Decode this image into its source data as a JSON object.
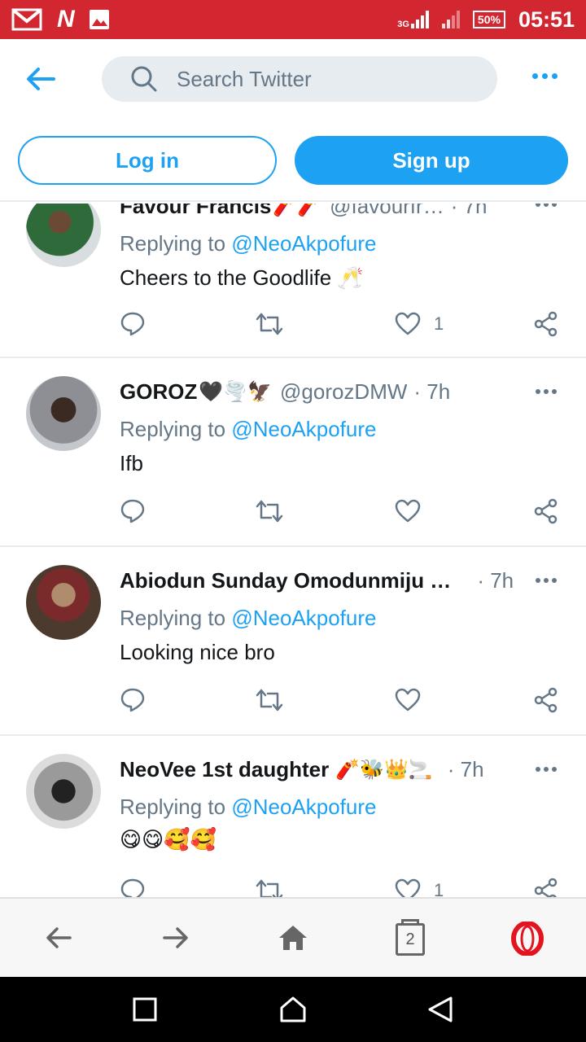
{
  "status_bar": {
    "network_type": "3G",
    "battery": "50%",
    "time": "05:51"
  },
  "header": {
    "search_placeholder": "Search Twitter",
    "login_label": "Log in",
    "signup_label": "Sign up"
  },
  "tweets": [
    {
      "name": "Favour Francis",
      "name_emoji": "🧨🧨",
      "handle": "@favourfr…",
      "time": "· 7h",
      "reply_prefix": "Replying to ",
      "reply_to": "@NeoAkpofure",
      "text": "Cheers to the Goodlife 🥂",
      "like_count": "1"
    },
    {
      "name": "GOROZ",
      "name_emoji": "🖤🌪️🦅",
      "handle": "@gorozDMW",
      "time": "· 7h",
      "reply_prefix": "Replying to ",
      "reply_to": "@NeoAkpofure",
      "text": "Ifb",
      "like_count": ""
    },
    {
      "name": "Abiodun Sunday Omodunmiju …",
      "name_emoji": "",
      "handle": "",
      "time": "· 7h",
      "reply_prefix": "Replying to ",
      "reply_to": "@NeoAkpofure",
      "text": "Looking nice bro",
      "like_count": ""
    },
    {
      "name": "NeoVee 1st daughter",
      "name_emoji": "🧨🐝👑🚬",
      "handle": "",
      "time": "· 7h",
      "reply_prefix": "Replying to ",
      "reply_to": "@NeoAkpofure",
      "text": "😋😋🥰🥰",
      "like_count": "1"
    }
  ],
  "bottom_nav": {
    "tab_count": "2"
  },
  "colors": {
    "status_bar": "#d22630",
    "accent": "#1da1f2",
    "secondary_text": "#657786",
    "opera_red": "#e3141f"
  }
}
